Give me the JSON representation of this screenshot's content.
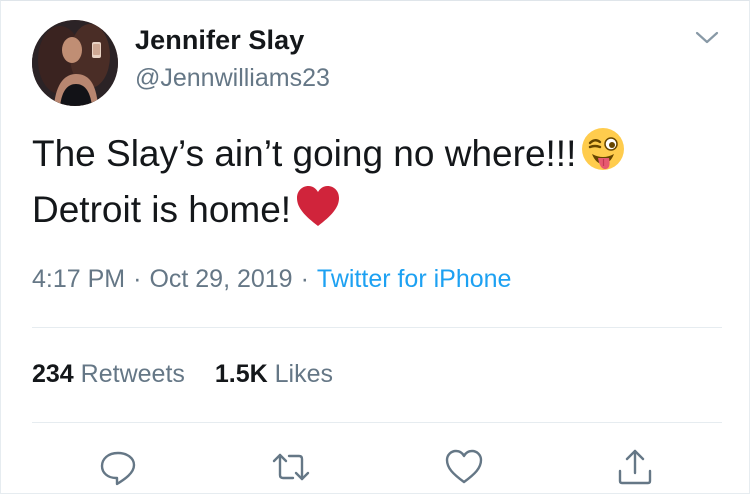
{
  "user": {
    "display_name": "Jennifer Slay",
    "handle": "@Jennwilliams23"
  },
  "tweet": {
    "line1": "The Slay’s ain’t going no where!!!",
    "line1_emoji": "winking-face-with-tongue-emoji",
    "line2": "Detroit is home!",
    "line2_emoji": "red-heart-emoji"
  },
  "meta": {
    "time": "4:17 PM",
    "separator": "·",
    "date": "Oct 29, 2019",
    "source": "Twitter for iPhone"
  },
  "stats": {
    "retweets_count": "234",
    "retweets_label": "Retweets",
    "likes_count": "1.5K",
    "likes_label": "Likes"
  },
  "icons": {
    "caret": "chevron-down-icon",
    "reply": "reply-icon",
    "retweet": "retweet-icon",
    "like": "heart-icon",
    "share": "share-icon"
  },
  "colors": {
    "text": "#14171a",
    "secondary": "#657786",
    "link": "#1da1f2",
    "divider": "#e6ecf0",
    "heart": "#d0243b"
  }
}
